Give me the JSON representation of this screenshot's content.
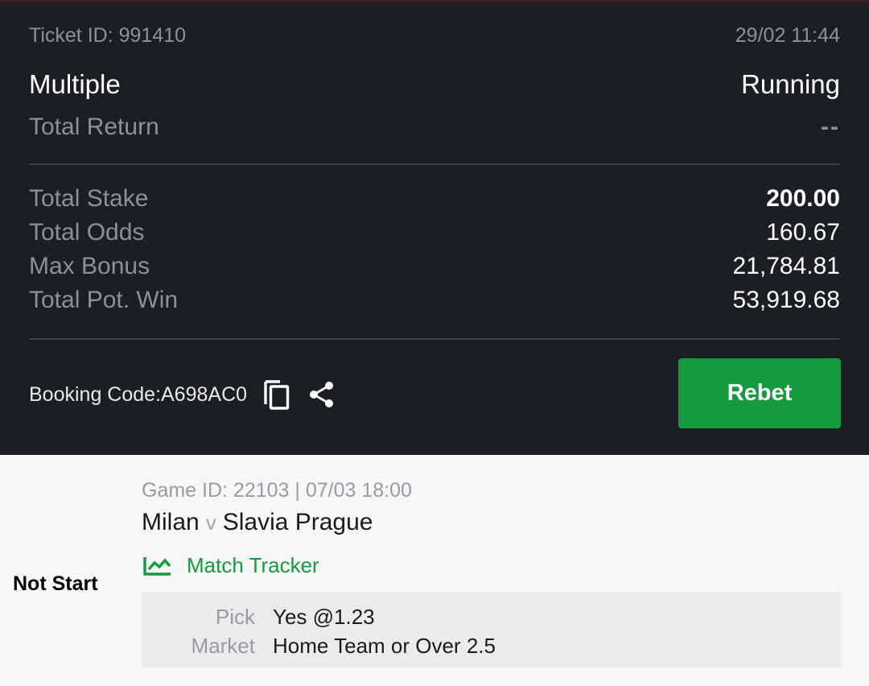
{
  "ticket": {
    "ticket_id": "Ticket ID: 991410",
    "datetime": "29/02 11:44",
    "bet_type": "Multiple",
    "status": "Running",
    "total_return_label": "Total Return",
    "total_return_value": "--",
    "stats": [
      {
        "label": "Total Stake",
        "value": "200.00"
      },
      {
        "label": "Total Odds",
        "value": "160.67"
      },
      {
        "label": "Max Bonus",
        "value": "21,784.81"
      },
      {
        "label": "Total Pot. Win",
        "value": "53,919.68"
      }
    ],
    "booking_code": "Booking Code:A698AC0",
    "rebet_label": "Rebet",
    "icons": {
      "copy": "copy-icon",
      "share": "share-icon"
    }
  },
  "game": {
    "state": "Not Start",
    "meta": "Game ID: 22103 | 07/03 18:00",
    "home": "Milan",
    "vs": "v",
    "away": "Slavia Prague",
    "tracker_label": "Match Tracker",
    "pick_label": "Pick",
    "pick_value": "Yes @1.23",
    "market_label": "Market",
    "market_value": "Home Team or Over 2.5"
  },
  "colors": {
    "ticket_bg": "#1c1e25",
    "accent_green": "#139b3e",
    "muted_text": "#8e9099",
    "page_bg": "#f7f7f8"
  }
}
